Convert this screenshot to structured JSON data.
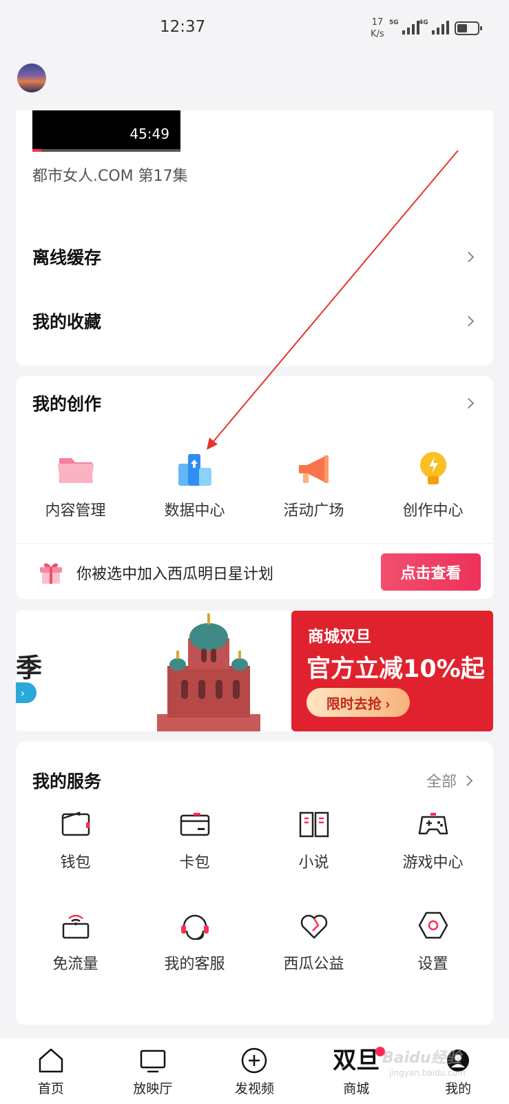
{
  "status_bar": {
    "time": "12:37",
    "speed_value": "17",
    "speed_unit": "K/s",
    "signal1": "5G",
    "signal2": "4G"
  },
  "history": {
    "duration": "45:49",
    "progress": 0.06,
    "title": "都市女人.COM 第17集"
  },
  "menu": {
    "offline_cache": "离线缓存",
    "favorites": "我的收藏"
  },
  "creation": {
    "title": "我的创作",
    "items": [
      {
        "label": "内容管理",
        "icon": "folder-icon"
      },
      {
        "label": "数据中心",
        "icon": "data-center-icon"
      },
      {
        "label": "活动广场",
        "icon": "megaphone-icon"
      },
      {
        "label": "创作中心",
        "icon": "lightbulb-icon"
      }
    ],
    "promo_text": "你被选中加入西瓜明日星计划",
    "promo_button": "点击查看"
  },
  "banner": {
    "left_text": "季",
    "red_tag": "商城双旦",
    "red_main": "官方立减10%起",
    "red_button": "限时去抢 ›"
  },
  "services": {
    "title": "我的服务",
    "all_label": "全部",
    "items": [
      {
        "label": "钱包",
        "icon": "wallet-icon"
      },
      {
        "label": "卡包",
        "icon": "card-icon"
      },
      {
        "label": "小说",
        "icon": "book-icon"
      },
      {
        "label": "游戏中心",
        "icon": "gamepad-icon"
      },
      {
        "label": "免流量",
        "icon": "free-data-icon"
      },
      {
        "label": "我的客服",
        "icon": "headset-icon"
      },
      {
        "label": "西瓜公益",
        "icon": "heart-icon"
      },
      {
        "label": "设置",
        "icon": "settings-icon"
      }
    ]
  },
  "bottom_nav": {
    "items": [
      {
        "label": "首页",
        "icon": "home-icon"
      },
      {
        "label": "放映厅",
        "icon": "tv-icon"
      },
      {
        "label": "发视频",
        "icon": "plus-circle-icon"
      },
      {
        "label": "商城",
        "logo": "双旦"
      },
      {
        "label": "我的",
        "icon": "profile-icon"
      }
    ]
  },
  "watermark": {
    "text": "Baidu经验",
    "sub": "jingyan.baidu.com"
  },
  "colors": {
    "accent": "#fe2c55",
    "banner_red": "#e0222e",
    "annotation_arrow": "#e5352c"
  }
}
